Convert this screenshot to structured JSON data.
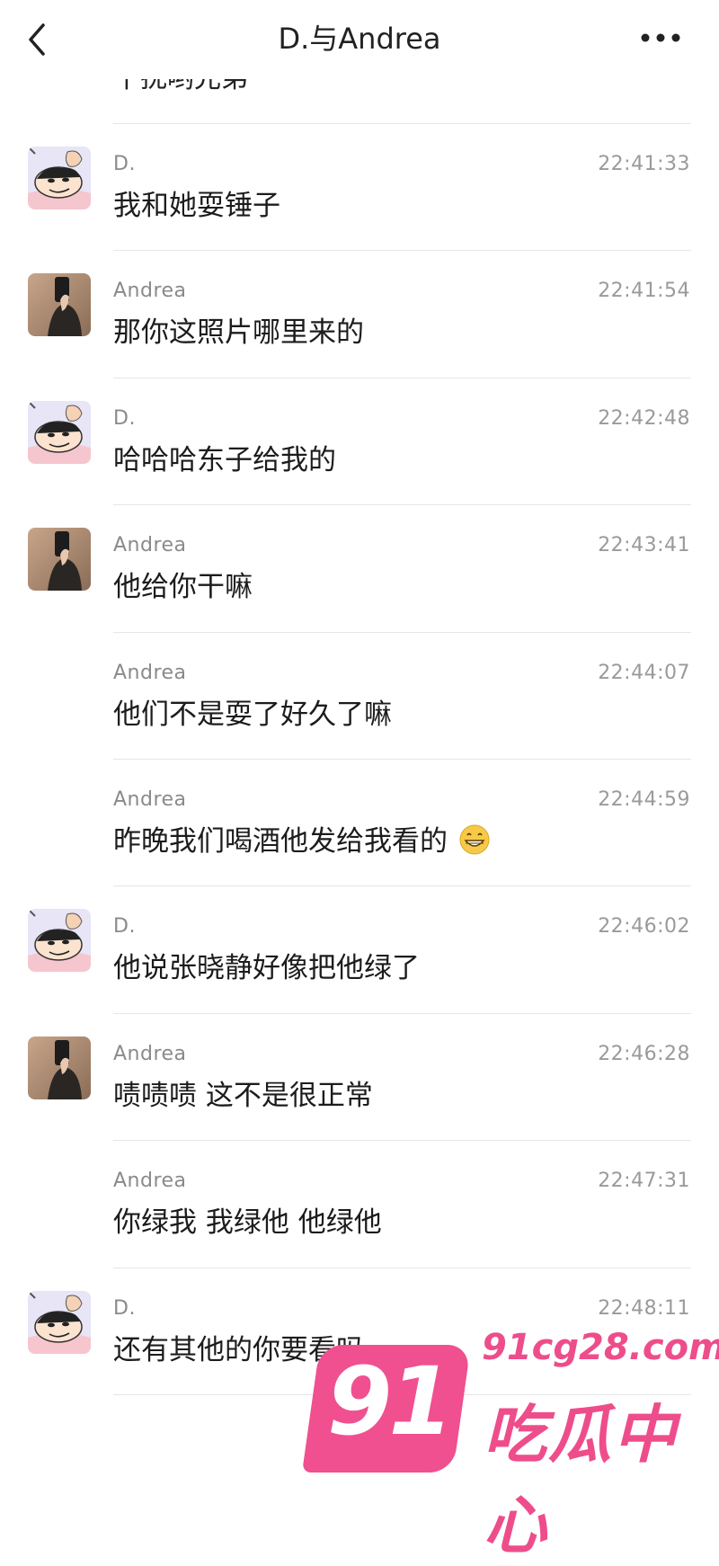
{
  "header": {
    "title": "D.与Andrea",
    "back_icon": "chevron-left-icon",
    "more_icon": "more-dots-icon"
  },
  "top_fragment": "干扰哟兄弟",
  "messages": [
    {
      "sender": "D.",
      "time": "22:41:33",
      "text": "我和她耍锤子",
      "avatar": "cartoon-avatar"
    },
    {
      "sender": "Andrea",
      "time": "22:41:54",
      "text": "那你这照片哪里来的",
      "avatar": "photo-avatar"
    },
    {
      "sender": "D.",
      "time": "22:42:48",
      "text": "哈哈哈东子给我的",
      "avatar": "cartoon-avatar"
    },
    {
      "sender": "Andrea",
      "time": "22:43:41",
      "text": "他给你干嘛",
      "avatar": "photo-avatar"
    },
    {
      "sender": "Andrea",
      "time": "22:44:07",
      "text": "他们不是耍了好久了嘛",
      "avatar": ""
    },
    {
      "sender": "Andrea",
      "time": "22:44:59",
      "text": "昨晚我们喝酒他发给我看的",
      "avatar": "",
      "emoji": "grin-emoji"
    },
    {
      "sender": "D.",
      "time": "22:46:02",
      "text": "他说张晓静好像把他绿了",
      "avatar": "cartoon-avatar"
    },
    {
      "sender": "Andrea",
      "time": "22:46:28",
      "text": "啧啧啧 这不是很正常",
      "avatar": "photo-avatar"
    },
    {
      "sender": "Andrea",
      "time": "22:47:31",
      "text": "你绿我 我绿他 他绿他",
      "avatar": ""
    },
    {
      "sender": "D.",
      "time": "22:48:11",
      "text": "还有其他的你要看吗",
      "avatar": "cartoon-avatar"
    }
  ],
  "watermark": {
    "number": "91",
    "domain": "91cg28.com",
    "name": "吃瓜中心",
    "color": "#ee4d8b"
  }
}
